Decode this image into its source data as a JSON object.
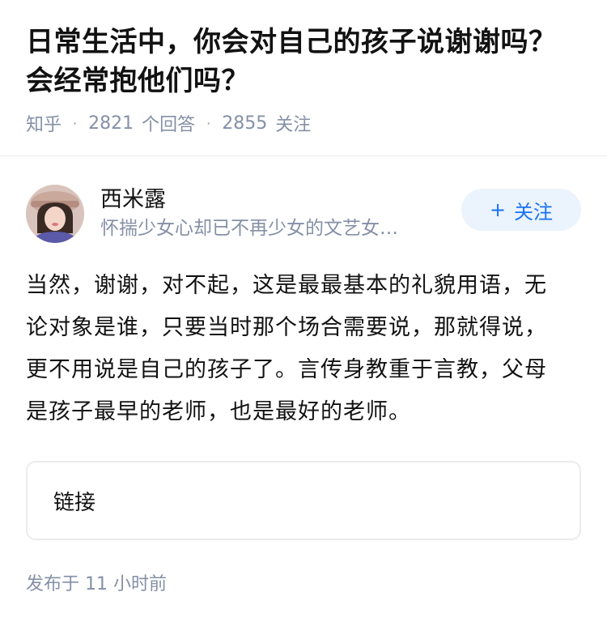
{
  "question": {
    "title": "日常生活中，你会对自己的孩子说谢谢吗？会经常抱他们吗？",
    "source": "知乎",
    "answers_count": "2821",
    "answers_label": "个回答",
    "followers_count": "2855",
    "followers_label": "关注"
  },
  "answer": {
    "author_name": "西米露",
    "author_bio": "怀揣少女心却已不再少女的文艺女…",
    "follow_label": "关注",
    "follow_icon": "+",
    "content": "当然，谢谢，对不起，这是最最基本的礼貌用语，无论对象是谁，只要当时那个场合需要说，那就得说，更不用说是自己的孩子了。言传身教重于言教，父母是孩子最早的老师，也是最好的老师。",
    "link_label": "链接",
    "publish_time": "发布于  11 小时前"
  },
  "colors": {
    "accent": "#1772f6",
    "accent_bg": "#ebf3fd",
    "meta": "#8590a6",
    "text": "#121212"
  }
}
